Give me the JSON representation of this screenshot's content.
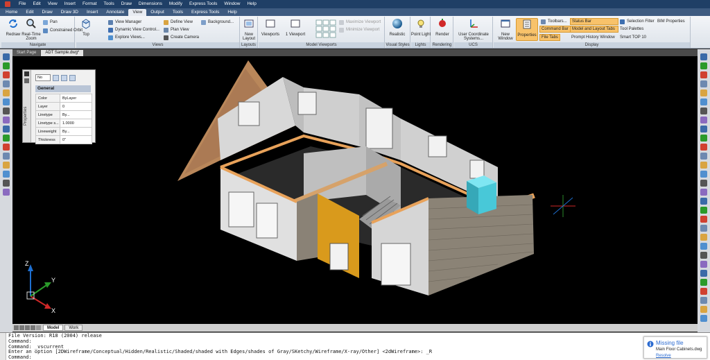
{
  "menubar": [
    "File",
    "Edit",
    "View",
    "Insert",
    "Format",
    "Tools",
    "Draw",
    "Dimensions",
    "Modify",
    "Express Tools",
    "Window",
    "Help"
  ],
  "ribbon_tabs": [
    "Home",
    "Edit",
    "Draw",
    "Draw 3D",
    "Insert",
    "Annotate",
    "View",
    "Output",
    "Tools",
    "Express Tools",
    "Help"
  ],
  "active_ribbon_tab": "View",
  "ribbon": {
    "navigate": {
      "label": "Navigate",
      "redraw": "Redraw",
      "realtime_zoom": "Real-Time Zoom",
      "pan": "Pan",
      "constrained_orbit": "Constrained Orbit"
    },
    "views": {
      "label": "Views",
      "top": "Top",
      "view_manager": "View Manager",
      "dynamic_view_control": "Dynamic View Control...",
      "explore_views": "Explore Views...",
      "define_view": "Define View",
      "plan_view": "Plan View",
      "create_camera": "Create Camera",
      "background": "Background..."
    },
    "layouts": {
      "label": "Layouts",
      "new_layout": "New Layout"
    },
    "model_viewports": {
      "label": "Model Viewports",
      "viewports": "Viewports",
      "one_viewport": "1 Viewport",
      "maximize_viewport": "Maximize Viewport",
      "minimize_viewport": "Minimize Viewport"
    },
    "visual_styles": {
      "label": "Visual Styles",
      "realistic": "Realistic"
    },
    "lights": {
      "label": "Lights",
      "point_light": "Point Light"
    },
    "rendering": {
      "label": "Rendering",
      "render": "Render"
    },
    "ucs": {
      "label": "UCS",
      "user_coordinate_systems": "User Coordinate Systems..."
    },
    "window": {
      "new_window": "New Window"
    },
    "display": {
      "label": "Display",
      "properties": "Properties",
      "toolbars": "Toolbars...",
      "command_bar": "Command Bar",
      "file_tabs": "File Tabs",
      "status_bar": "Status Bar",
      "model_and_layout_tabs": "Model and Layout Tabs",
      "prompt_history_window": "Prompt History Window",
      "selection_filter": "Selection Filter",
      "bim_properties": "BIM Properties",
      "tool_palettes": "Tool Palettes",
      "smart_top10": "Smart TOP 10"
    }
  },
  "doc_tabs": [
    "Start Page",
    "ADT Sample.dwg*"
  ],
  "active_doc_tab": "ADT Sample.dwg*",
  "properties_palette": {
    "side_title": "Properties",
    "selection": "No",
    "group": "General",
    "rows": [
      {
        "key": "Color",
        "value": "ByLayer"
      },
      {
        "key": "Layer",
        "value": "0"
      },
      {
        "key": "Linetype",
        "value": "By..."
      },
      {
        "key": "Linetype s...",
        "value": "1.0000"
      },
      {
        "key": "Lineweight",
        "value": "By..."
      },
      {
        "key": "Thickness",
        "value": "0\""
      }
    ]
  },
  "ucs_axes": {
    "x": "X",
    "y": "Y",
    "z": "Z"
  },
  "layout_tabs": [
    "Model",
    "Work"
  ],
  "active_layout_tab": "Model",
  "command_lines": [
    "File Version: R18 (2004) release",
    "Command:",
    "Command: _vscurrent",
    "Enter an option [2DWireframe/Conceptual/Hidden/Realistic/Shaded/shaded with Edges/shades of Gray/SKetchy/Wireframe/X-ray/Other] <2dWireframe>: _R",
    "Command:"
  ],
  "notification": {
    "title": "Missing file",
    "file": "Main Floor Cabinets.dwg",
    "action": "Resolve"
  },
  "colors": {
    "menubar": "#1f3f66",
    "canvas": "#000000",
    "wall": "#c9c9c9",
    "wall_top": "#e8a25a",
    "accent_panel": "#d99a1c",
    "cyan_block": "#48c8d8"
  }
}
